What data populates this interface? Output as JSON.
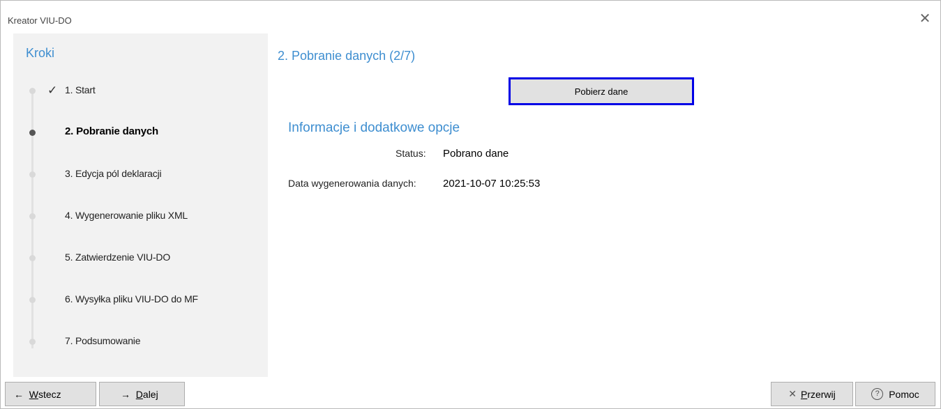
{
  "window": {
    "title": "Kreator VIU-DO",
    "close_glyph": "✕"
  },
  "sidebar": {
    "title": "Kroki",
    "check_glyph": "✓",
    "steps": [
      {
        "label": "1. Start",
        "state": "done"
      },
      {
        "label": "2. Pobranie danych",
        "state": "active"
      },
      {
        "label": "3. Edycja pól deklaracji",
        "state": "pending"
      },
      {
        "label": "4. Wygenerowanie pliku XML",
        "state": "pending"
      },
      {
        "label": "5. Zatwierdzenie VIU-DO",
        "state": "pending"
      },
      {
        "label": "6. Wysyłka pliku VIU-DO do MF",
        "state": "pending"
      },
      {
        "label": "7. Podsumowanie",
        "state": "pending"
      }
    ]
  },
  "main": {
    "title": "2. Pobranie danych (2/7)",
    "fetch_button_label": "Pobierz dane",
    "section_title": "Informacje i dodatkowe opcje",
    "status_label": "Status:",
    "status_value": "Pobrano dane",
    "date_label": "Data wygenerowania danych:",
    "date_value": "2021-10-07 10:25:53"
  },
  "footer": {
    "back": {
      "arrow": "←",
      "accel": "W",
      "rest": "stecz"
    },
    "next": {
      "arrow": "→",
      "accel": "D",
      "rest": "alej"
    },
    "abort": {
      "icon": "✕",
      "accel": "P",
      "rest": "rzerwij"
    },
    "help": {
      "icon": "?",
      "label": "Pomoc"
    }
  },
  "colors": {
    "accent": "#3e8ed0",
    "focus_border": "#0000e6",
    "sidebar_bg": "#f2f2f2",
    "button_bg": "#e1e1e1"
  }
}
